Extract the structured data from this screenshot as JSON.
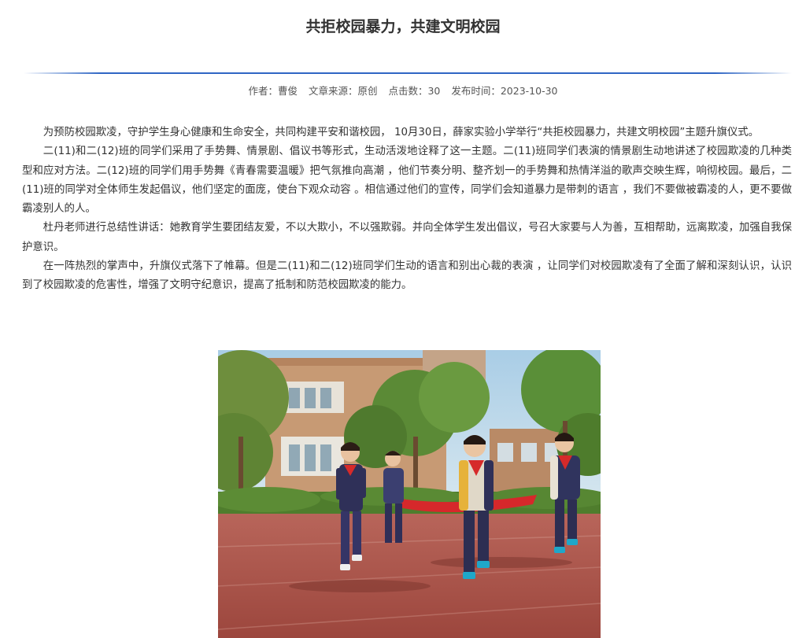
{
  "article": {
    "title": "共拒校园暴力，共建文明校园",
    "meta": {
      "author": "作者：曹俊",
      "source": "文章来源：原创",
      "clicks": "点击数：30",
      "published": "发布时间：2023-10-30"
    },
    "paragraphs": [
      "为预防校园欺凌，守护学生身心健康和生命安全，共同构建平安和谐校园， 10月30日，薛家实验小学举行“共拒校园暴力，共建文明校园”主题升旗仪式。",
      "二(11)和二(12)班的同学们采用了手势舞、情景剧、倡议书等形式，生动活泼地诠释了这一主题。二(11)班同学们表演的情景剧生动地讲述了校园欺凌的几种类型和应对方法。二(12)班的同学们用手势舞《青春需要温暖》把气氛推向高潮 ，他们节奏分明、整齐划一的手势舞和热情洋溢的歌声交映生辉，响彻校园。最后，二(11)班的同学对全体师生发起倡议，他们坚定的面庞，使台下观众动容 。相信通过他们的宣传，同学们会知道暴力是带刺的语言 ，我们不要做被霸凌的人，更不要做霸凌别人的人。",
      "杜丹老师进行总结性讲话：她教育学生要团结友爱，不以大欺小，不以强欺弱。并向全体学生发出倡议，号召大家要与人为善，互相帮助，远离欺凌，加强自我保护意识。",
      "在一阵热烈的掌声中，升旗仪式落下了帷幕。但是二(11)和二(12)班同学们生动的语言和别出心裁的表演 ，让同学们对校园欺凌有了全面了解和深刻认识，认识到了校园欺凌的危害性，增强了文明守纪意识，提高了抵制和防范校园欺凌的能力。"
    ]
  },
  "photo": {
    "icon": "children-running-photo",
    "colors": {
      "sky": "#b9d6e8",
      "track": "#a9524a",
      "foliage": "#5d8a3a",
      "building": "#c9a07a",
      "banner": "#d92b2b"
    }
  }
}
